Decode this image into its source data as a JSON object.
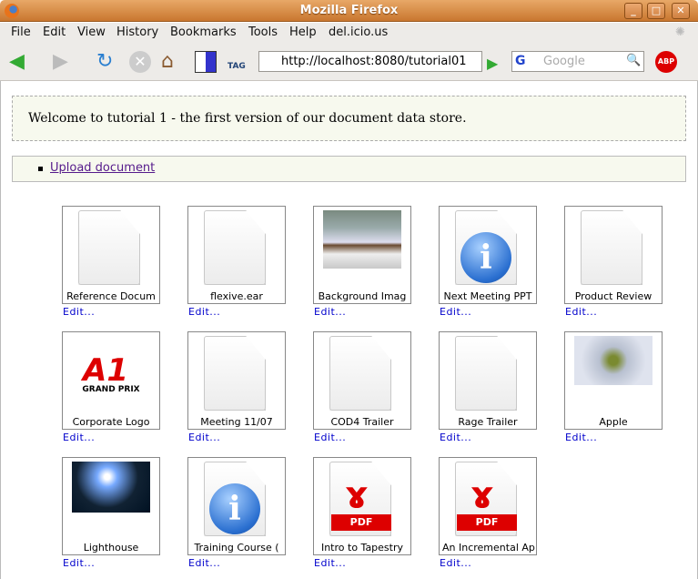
{
  "window": {
    "title": "Mozilla Firefox"
  },
  "menu": [
    "File",
    "Edit",
    "View",
    "History",
    "Bookmarks",
    "Tools",
    "Help",
    "del.icio.us"
  ],
  "toolbar": {
    "url": "http://localhost:8080/tutorial01",
    "search_placeholder": "Google",
    "tag_label": "TAG",
    "abp_label": "ABP"
  },
  "page": {
    "welcome": "Welcome to tutorial 1 - the first version of our document data store.",
    "upload_link": "Upload document",
    "edit_label": "Edit..."
  },
  "documents": [
    {
      "caption": "Reference Docum",
      "type": "doc"
    },
    {
      "caption": "flexive.ear",
      "type": "doc"
    },
    {
      "caption": "Background Imag",
      "type": "painting"
    },
    {
      "caption": "Next Meeting PPT",
      "type": "info"
    },
    {
      "caption": "Product Review",
      "type": "doc"
    },
    {
      "caption": "Corporate Logo",
      "type": "logo",
      "logo_text": "GRAND PRIX"
    },
    {
      "caption": "Meeting 11/07",
      "type": "doc"
    },
    {
      "caption": "COD4 Trailer",
      "type": "doc"
    },
    {
      "caption": "Rage Trailer",
      "type": "doc"
    },
    {
      "caption": "Apple",
      "type": "apple"
    },
    {
      "caption": "Lighthouse",
      "type": "lighthouse"
    },
    {
      "caption": "Training Course (",
      "type": "info"
    },
    {
      "caption": "Intro to Tapestry",
      "type": "pdf"
    },
    {
      "caption": "An Incremental Ap",
      "type": "pdf"
    }
  ],
  "pdf_label": "PDF"
}
